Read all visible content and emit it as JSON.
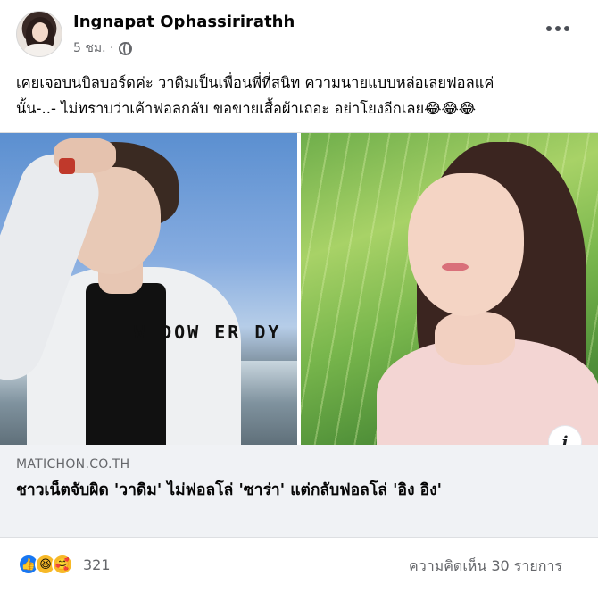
{
  "post": {
    "author": "Ingnapat Ophassirirathh",
    "time": "5 ชม. ·",
    "privacy_icon": "globe-icon",
    "more_icon": "more-options-icon",
    "caption_lines": [
      "เคยเจอบนบิลบอร์ดค่ะ วาดิมเป็นเพื่อนพี่ที่สนิท ความนายแบบหล่อเลยฟอลแค่",
      "นั้น-..- ไม่ทราบว่าเค้าฟอลกลับ ขอขายเสื้อผ้าเถอะ อย่าโยงอีกเลย😂😂😂"
    ]
  },
  "link_preview": {
    "domain": "MATICHON.CO.TH",
    "headline": "ชาวเน็ตจับผิด 'วาดิม' ไม่ฟอลโล่ 'ซาร่า' แต่กลับฟอลโล่ 'อิง อิง'",
    "info_label": "i",
    "left_image_text": "W DOW ER DY"
  },
  "footer": {
    "reaction_icons": [
      "like-icon",
      "haha-icon",
      "care-icon"
    ],
    "reaction_emoji": {
      "like": "👍",
      "haha": "😆",
      "care": "🥰"
    },
    "reaction_count": "321",
    "comments": "ความคิดเห็น 30 รายการ"
  },
  "colors": {
    "link_box_bg": "#f0f2f5",
    "secondary_text": "#65676b",
    "like_blue": "#1877f2"
  }
}
